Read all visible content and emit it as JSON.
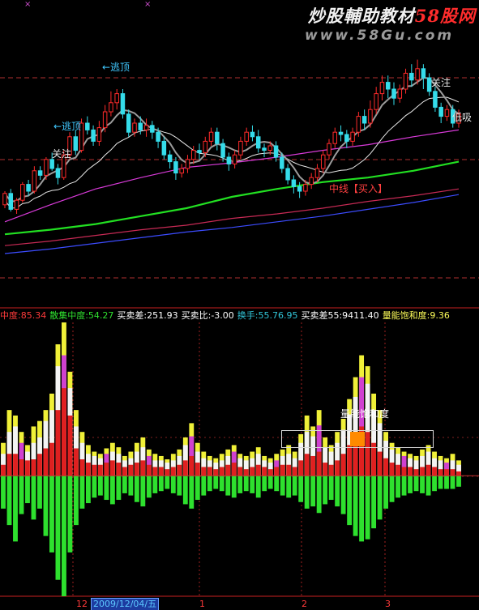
{
  "watermark": {
    "brand_a": "炒股輔助教材",
    "brand_b": "58股网",
    "url": "www.58Gu.com"
  },
  "annotations": {
    "top1": "←逃顶",
    "top2": "←逃顶",
    "b1": "关注",
    "b2": "关注",
    "b3": "低吸",
    "midline": "中线【买入】",
    "saturation_title": "量能饱和度"
  },
  "indicator_bar": [
    {
      "text": "中度:85.34",
      "color": "#ff3b3b"
    },
    {
      "text": "散集中度:54.27",
      "color": "#2fe02f"
    },
    {
      "text": "买卖差:251.93",
      "color": "#ffffff"
    },
    {
      "text": "买卖比:-3.00",
      "color": "#ffffff"
    },
    {
      "text": "换手:55.76.95",
      "color": "#31c5d8"
    },
    {
      "text": "买卖差55:9411.40",
      "color": "#ffffff"
    },
    {
      "text": "量能饱和度:9.36",
      "color": "#ffff5a"
    }
  ],
  "gauge": {
    "fill_start": 0.45,
    "fill_end": 0.55
  },
  "timeline": {
    "date": "2009/12/04/五",
    "ticks": [
      "12",
      "1",
      "2",
      "3"
    ]
  },
  "colors": {
    "up": "#ff2a2a",
    "down": "#35dcea",
    "ma_green": "#22e022",
    "ma_blue": "#3c4cff",
    "ma_red": "#c82a55",
    "ma_magenta": "#d83ad8",
    "ma_white": "#e8e8e8",
    "ma_gray": "#9c9c9c"
  },
  "chart_data": {
    "type": "candlestick_with_histogram",
    "price": {
      "ma_levels": {
        "green": [
          22,
          26,
          31,
          38,
          45,
          55,
          62,
          68,
          72,
          78,
          86
        ],
        "blue": [
          5,
          9,
          14,
          19,
          24,
          28,
          33,
          38,
          44,
          50,
          57
        ],
        "red": [
          12,
          16,
          21,
          26,
          30,
          36,
          40,
          45,
          51,
          56,
          62
        ],
        "magenta": [
          33,
          48,
          62,
          72,
          81,
          85,
          90,
          96,
          101,
          108,
          114
        ]
      },
      "candles": [
        [
          48,
          58,
          45,
          60
        ],
        [
          58,
          44,
          42,
          62
        ],
        [
          44,
          52,
          40,
          54
        ],
        [
          52,
          66,
          50,
          68
        ],
        [
          66,
          60,
          56,
          70
        ],
        [
          60,
          78,
          58,
          82
        ],
        [
          78,
          74,
          70,
          82
        ],
        [
          74,
          88,
          70,
          90
        ],
        [
          88,
          80,
          78,
          94
        ],
        [
          80,
          72,
          66,
          84
        ],
        [
          72,
          92,
          70,
          96
        ],
        [
          92,
          108,
          88,
          112
        ],
        [
          108,
          96,
          92,
          114
        ],
        [
          96,
          120,
          94,
          124
        ],
        [
          120,
          114,
          110,
          126
        ],
        [
          114,
          104,
          100,
          118
        ],
        [
          104,
          116,
          100,
          122
        ],
        [
          116,
          130,
          112,
          136
        ],
        [
          130,
          138,
          126,
          148
        ],
        [
          138,
          146,
          132,
          150
        ],
        [
          146,
          128,
          124,
          150
        ],
        [
          128,
          112,
          108,
          132
        ],
        [
          112,
          120,
          108,
          124
        ],
        [
          120,
          114,
          110,
          126
        ],
        [
          114,
          118,
          108,
          124
        ],
        [
          118,
          112,
          106,
          122
        ],
        [
          112,
          104,
          98,
          116
        ],
        [
          104,
          92,
          88,
          108
        ],
        [
          92,
          86,
          80,
          96
        ],
        [
          86,
          76,
          70,
          90
        ],
        [
          76,
          80,
          72,
          84
        ],
        [
          80,
          88,
          76,
          92
        ],
        [
          88,
          96,
          84,
          100
        ],
        [
          96,
          94,
          88,
          102
        ],
        [
          94,
          104,
          90,
          108
        ],
        [
          104,
          112,
          100,
          116
        ],
        [
          112,
          102,
          96,
          116
        ],
        [
          102,
          90,
          86,
          106
        ],
        [
          90,
          84,
          78,
          94
        ],
        [
          84,
          92,
          80,
          96
        ],
        [
          92,
          104,
          88,
          108
        ],
        [
          104,
          112,
          100,
          116
        ],
        [
          112,
          108,
          104,
          118
        ],
        [
          108,
          98,
          94,
          114
        ],
        [
          98,
          96,
          90,
          102
        ],
        [
          96,
          100,
          92,
          104
        ],
        [
          100,
          90,
          86,
          104
        ],
        [
          90,
          80,
          76,
          94
        ],
        [
          80,
          70,
          66,
          84
        ],
        [
          70,
          64,
          58,
          74
        ],
        [
          64,
          60,
          54,
          68
        ],
        [
          60,
          66,
          56,
          70
        ],
        [
          66,
          72,
          62,
          76
        ],
        [
          72,
          80,
          68,
          84
        ],
        [
          80,
          92,
          76,
          96
        ],
        [
          92,
          102,
          88,
          106
        ],
        [
          102,
          112,
          98,
          116
        ],
        [
          112,
          110,
          104,
          118
        ],
        [
          110,
          104,
          98,
          114
        ],
        [
          104,
          112,
          100,
          116
        ],
        [
          112,
          126,
          108,
          130
        ],
        [
          126,
          120,
          114,
          132
        ],
        [
          120,
          132,
          116,
          140
        ],
        [
          132,
          146,
          128,
          152
        ],
        [
          146,
          156,
          140,
          162
        ],
        [
          156,
          150,
          142,
          162
        ],
        [
          150,
          142,
          136,
          156
        ],
        [
          142,
          150,
          138,
          154
        ],
        [
          150,
          164,
          146,
          168
        ],
        [
          164,
          158,
          152,
          172
        ],
        [
          158,
          168,
          154,
          176
        ],
        [
          168,
          160,
          150,
          172
        ],
        [
          160,
          148,
          144,
          164
        ],
        [
          148,
          134,
          130,
          152
        ],
        [
          134,
          126,
          120,
          138
        ],
        [
          126,
          132,
          122,
          136
        ],
        [
          132,
          120,
          116,
          136
        ],
        [
          120,
          128,
          116,
          132
        ]
      ],
      "ylim": [
        0,
        200
      ]
    },
    "volume": {
      "ylim": [
        -110,
        140
      ],
      "bars": [
        {
          "v": [
            30,
            20,
            10,
            -30
          ]
        },
        {
          "v": [
            60,
            40,
            20,
            -45
          ]
        },
        {
          "v": [
            55,
            45,
            20,
            -60
          ]
        },
        {
          "v": [
            40,
            30,
            15,
            -35
          ]
        },
        {
          "v": [
            28,
            22,
            14,
            -25
          ]
        },
        {
          "v": [
            45,
            30,
            15,
            -40
          ]
        },
        {
          "v": [
            50,
            35,
            20,
            -30
          ]
        },
        {
          "v": [
            60,
            50,
            25,
            -55
          ]
        },
        {
          "v": [
            75,
            60,
            30,
            -70
          ]
        },
        {
          "v": [
            120,
            100,
            60,
            -95
          ]
        },
        {
          "v": [
            140,
            110,
            80,
            -110
          ]
        },
        {
          "v": [
            95,
            80,
            55,
            -70
          ]
        },
        {
          "v": [
            60,
            45,
            25,
            -45
          ]
        },
        {
          "v": [
            40,
            30,
            15,
            -30
          ]
        },
        {
          "v": [
            28,
            20,
            12,
            -25
          ]
        },
        {
          "v": [
            22,
            18,
            10,
            -20
          ]
        },
        {
          "v": [
            20,
            16,
            10,
            -18
          ]
        },
        {
          "v": [
            25,
            20,
            12,
            -22
          ]
        },
        {
          "v": [
            30,
            22,
            14,
            -26
          ]
        },
        {
          "v": [
            26,
            20,
            12,
            -22
          ]
        },
        {
          "v": [
            18,
            14,
            8,
            -16
          ]
        },
        {
          "v": [
            22,
            16,
            10,
            -18
          ]
        },
        {
          "v": [
            30,
            22,
            12,
            -24
          ]
        },
        {
          "v": [
            35,
            26,
            14,
            -28
          ]
        },
        {
          "v": [
            24,
            18,
            10,
            -20
          ]
        },
        {
          "v": [
            20,
            14,
            8,
            -16
          ]
        },
        {
          "v": [
            18,
            14,
            8,
            -14
          ]
        },
        {
          "v": [
            15,
            12,
            6,
            -12
          ]
        },
        {
          "v": [
            20,
            14,
            8,
            -16
          ]
        },
        {
          "v": [
            24,
            18,
            10,
            -18
          ]
        },
        {
          "v": [
            35,
            28,
            14,
            -26
          ]
        },
        {
          "v": [
            48,
            36,
            18,
            -30
          ]
        },
        {
          "v": [
            30,
            22,
            12,
            -22
          ]
        },
        {
          "v": [
            22,
            16,
            8,
            -18
          ]
        },
        {
          "v": [
            18,
            14,
            8,
            -14
          ]
        },
        {
          "v": [
            16,
            12,
            6,
            -12
          ]
        },
        {
          "v": [
            20,
            14,
            8,
            -14
          ]
        },
        {
          "v": [
            24,
            18,
            10,
            -18
          ]
        },
        {
          "v": [
            28,
            22,
            12,
            -20
          ]
        },
        {
          "v": [
            20,
            16,
            8,
            -16
          ]
        },
        {
          "v": [
            18,
            14,
            6,
            -14
          ]
        },
        {
          "v": [
            22,
            16,
            8,
            -16
          ]
        },
        {
          "v": [
            26,
            20,
            10,
            -20
          ]
        },
        {
          "v": [
            18,
            14,
            8,
            -14
          ]
        },
        {
          "v": [
            16,
            12,
            6,
            -12
          ]
        },
        {
          "v": [
            20,
            14,
            8,
            -14
          ]
        },
        {
          "v": [
            24,
            18,
            10,
            -18
          ]
        },
        {
          "v": [
            28,
            20,
            10,
            -20
          ]
        },
        {
          "v": [
            22,
            16,
            8,
            -18
          ]
        },
        {
          "v": [
            38,
            30,
            14,
            -24
          ]
        },
        {
          "v": [
            55,
            40,
            20,
            -30
          ]
        },
        {
          "v": [
            45,
            36,
            18,
            -28
          ]
        },
        {
          "v": [
            60,
            46,
            22,
            -34
          ]
        },
        {
          "v": [
            35,
            26,
            12,
            -26
          ]
        },
        {
          "v": [
            28,
            22,
            10,
            -22
          ]
        },
        {
          "v": [
            40,
            30,
            14,
            -28
          ]
        },
        {
          "v": [
            52,
            42,
            20,
            -35
          ]
        },
        {
          "v": [
            70,
            56,
            28,
            -45
          ]
        },
        {
          "v": [
            90,
            72,
            36,
            -55
          ]
        },
        {
          "v": [
            110,
            90,
            45,
            -60
          ]
        },
        {
          "v": [
            100,
            84,
            40,
            -58
          ]
        },
        {
          "v": [
            75,
            60,
            30,
            -48
          ]
        },
        {
          "v": [
            60,
            48,
            22,
            -40
          ]
        },
        {
          "v": [
            40,
            32,
            16,
            -30
          ]
        },
        {
          "v": [
            30,
            24,
            12,
            -24
          ]
        },
        {
          "v": [
            26,
            20,
            10,
            -20
          ]
        },
        {
          "v": [
            22,
            18,
            8,
            -18
          ]
        },
        {
          "v": [
            20,
            16,
            8,
            -16
          ]
        },
        {
          "v": [
            18,
            14,
            6,
            -14
          ]
        },
        {
          "v": [
            24,
            18,
            8,
            -16
          ]
        },
        {
          "v": [
            28,
            22,
            10,
            -18
          ]
        },
        {
          "v": [
            22,
            16,
            8,
            -14
          ]
        },
        {
          "v": [
            18,
            14,
            6,
            -12
          ]
        },
        {
          "v": [
            16,
            12,
            6,
            -12
          ]
        },
        {
          "v": [
            20,
            14,
            6,
            -12
          ]
        },
        {
          "v": [
            14,
            10,
            4,
            -10
          ]
        }
      ]
    }
  }
}
